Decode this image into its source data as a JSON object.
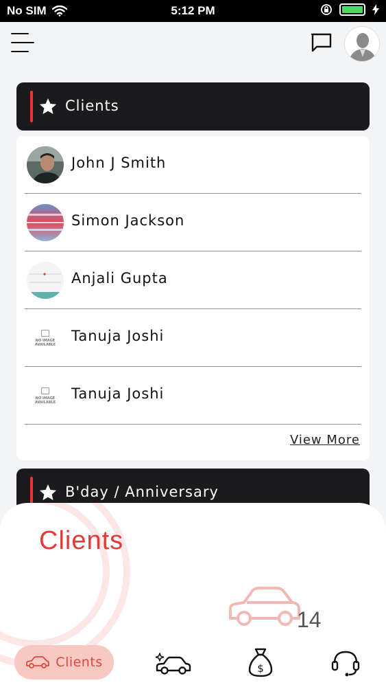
{
  "status_bar": {
    "carrier": "No SIM",
    "time": "5:12 PM",
    "battery_color": "#4cd964"
  },
  "header": {
    "menu_icon": "hamburger-icon",
    "chat_icon": "chat-icon",
    "avatar_icon": "user-avatar-icon"
  },
  "clients_section": {
    "title": "Clients",
    "icon": "star-icon",
    "items": [
      {
        "name": "John J Smith",
        "avatar": "photo"
      },
      {
        "name": "Simon Jackson",
        "avatar": "photo"
      },
      {
        "name": "Anjali Gupta",
        "avatar": "photo"
      },
      {
        "name": "Tanuja Joshi",
        "avatar": "no-image"
      },
      {
        "name": "Tanuja Joshi",
        "avatar": "no-image"
      }
    ],
    "no_image_text": "NO IMAGE AVAILABLE",
    "view_more_label": "View More"
  },
  "bday_section": {
    "title": "B'day / Anniversary",
    "icon": "star-icon"
  },
  "bottom_sheet": {
    "title": "Clients",
    "count": "14",
    "icon": "car-icon"
  },
  "bottom_nav": {
    "items": [
      {
        "label": "Clients",
        "icon": "car-icon",
        "active": true
      },
      {
        "label": "",
        "icon": "sparkle-car-icon",
        "active": false
      },
      {
        "label": "",
        "icon": "money-bag-icon",
        "active": false
      },
      {
        "label": "",
        "icon": "headset-icon",
        "active": false
      }
    ]
  },
  "colors": {
    "accent": "#e53935",
    "dark_card": "#1b1b1d",
    "nav_active_bg": "#f8c8c2"
  }
}
